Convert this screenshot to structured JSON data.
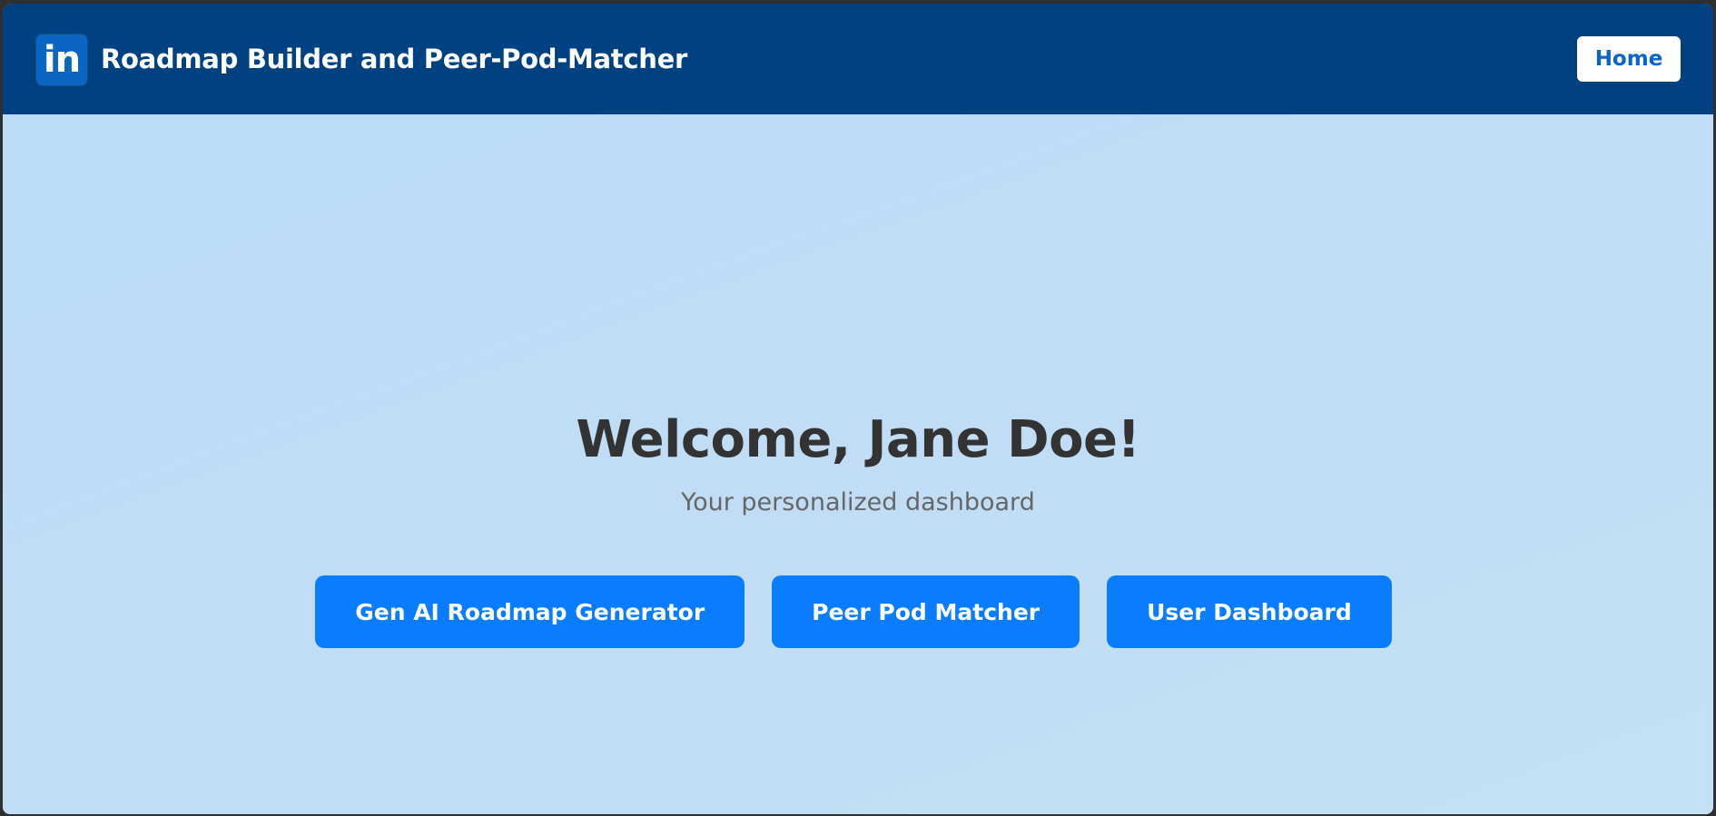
{
  "header": {
    "logo_text": "in",
    "logo_icon": "linkedin-logo-icon",
    "title": "Roadmap Builder and Peer-Pod-Matcher",
    "home_label": "Home"
  },
  "main": {
    "welcome": "Welcome, Jane Doe!",
    "subtitle": "Your personalized dashboard",
    "buttons": [
      {
        "label": "Gen AI Roadmap Generator"
      },
      {
        "label": "Peer Pod Matcher"
      },
      {
        "label": "User Dashboard"
      }
    ]
  },
  "colors": {
    "navbar": "#004182",
    "page_background": "#bfdcf5",
    "primary_button": "#0a7cff",
    "logo_background": "#0a66c2",
    "home_text": "#0a66c2",
    "heading_text": "#333333",
    "subtitle_text": "#666666"
  }
}
